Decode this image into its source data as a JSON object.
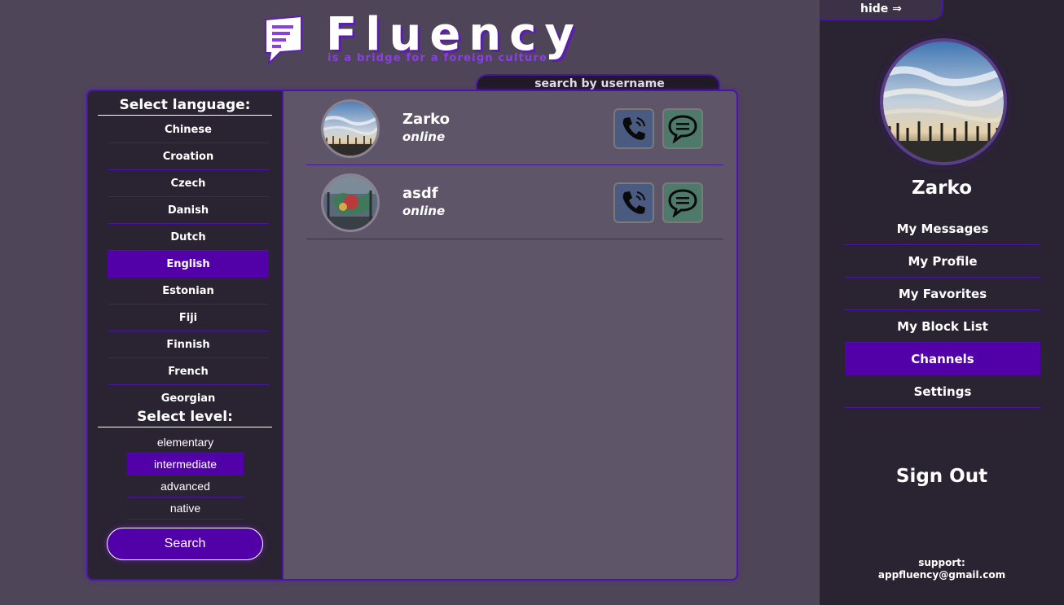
{
  "brand": {
    "title": "Fluency",
    "tagline": "is a bridge for a foreign culture",
    "accent_color": "#5200a8",
    "icon": "document-chat-icon"
  },
  "search_username": {
    "label": "search by username"
  },
  "filters": {
    "language_heading": "Select language:",
    "languages": [
      {
        "label": "Chinese"
      },
      {
        "label": "Croation"
      },
      {
        "label": "Czech"
      },
      {
        "label": "Danish"
      },
      {
        "label": "Dutch"
      },
      {
        "label": "English",
        "selected": true
      },
      {
        "label": "Estonian"
      },
      {
        "label": "Fiji"
      },
      {
        "label": "Finnish"
      },
      {
        "label": "French"
      },
      {
        "label": "Georgian"
      }
    ],
    "level_heading": "Select level:",
    "levels": [
      {
        "label": "elementary"
      },
      {
        "label": "intermediate",
        "selected": true
      },
      {
        "label": "advanced"
      },
      {
        "label": "native"
      }
    ],
    "search_button": "Search"
  },
  "users": [
    {
      "name": "Zarko",
      "status": "online",
      "avatar": "sky-landscape-photo",
      "call_icon": "phone-icon",
      "chat_icon": "chat-bubble-icon"
    },
    {
      "name": "asdf",
      "status": "online",
      "avatar": "graffiti-photo",
      "call_icon": "phone-icon",
      "chat_icon": "chat-bubble-icon"
    }
  ],
  "sidebar": {
    "hide_label": "hide ⇒",
    "profile_name": "Zarko",
    "profile_avatar": "sky-landscape-photo",
    "menu": [
      {
        "label": "My Messages"
      },
      {
        "label": "My Profile"
      },
      {
        "label": "My Favorites"
      },
      {
        "label": "My Block List"
      },
      {
        "label": "Channels",
        "selected": true
      },
      {
        "label": "Settings"
      }
    ],
    "sign_out": "Sign Out",
    "support_label": "support:",
    "support_email": "appfluency@gmail.com"
  }
}
